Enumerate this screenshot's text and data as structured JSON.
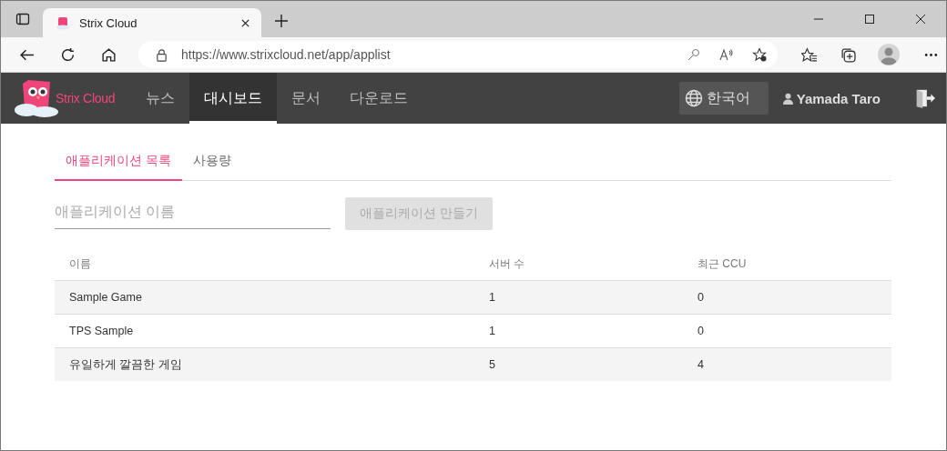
{
  "browser": {
    "tab_title": "Strix Cloud",
    "url": "https://www.strixcloud.net/app/applist"
  },
  "header": {
    "brand": "Strix Cloud",
    "nav": [
      {
        "label": "뉴스",
        "selected": false
      },
      {
        "label": "대시보드",
        "selected": true
      },
      {
        "label": "문서",
        "selected": false
      },
      {
        "label": "다운로드",
        "selected": false
      }
    ],
    "language": "한국어",
    "user": "Yamada Taro"
  },
  "tabs": [
    {
      "label": "애플리케이션 목록",
      "selected": true
    },
    {
      "label": "사용량",
      "selected": false
    }
  ],
  "name_field": {
    "placeholder": "애플리케이션 이름"
  },
  "create_button": {
    "label": "애플리케이션 만들기",
    "disabled": true
  },
  "table": {
    "columns": [
      "이름",
      "서버 수",
      "최근 CCU"
    ],
    "rows": [
      [
        "Sample Game",
        "1",
        "0"
      ],
      [
        "TPS Sample",
        "1",
        "0"
      ],
      [
        "유일하게 깔끔한 게임",
        "5",
        "4"
      ]
    ]
  }
}
